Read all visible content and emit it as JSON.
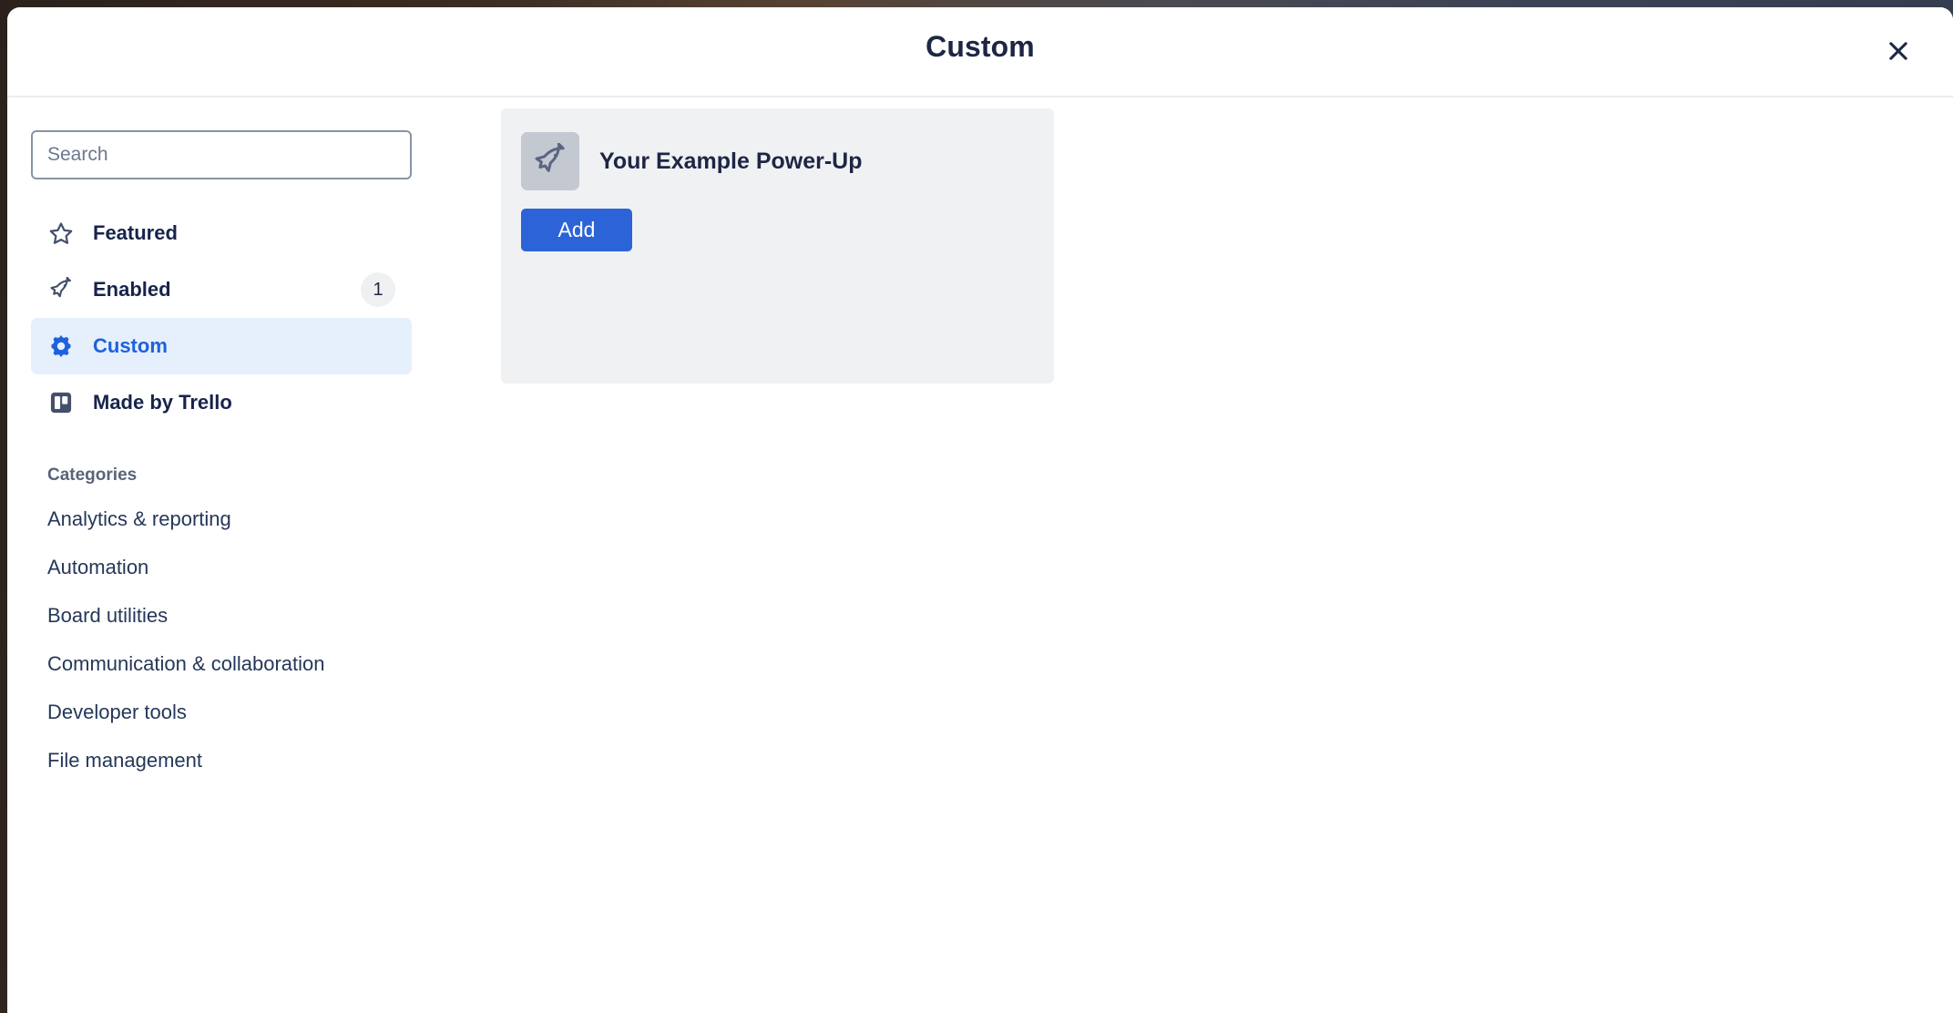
{
  "window": {
    "title": "Custom",
    "close_icon": "close-icon"
  },
  "search": {
    "placeholder": "Search",
    "value": ""
  },
  "sidebar": {
    "items": [
      {
        "label": "Featured",
        "icon": "star-icon",
        "selected": false,
        "badge": ""
      },
      {
        "label": "Enabled",
        "icon": "rocket-icon",
        "selected": false,
        "badge": "1"
      },
      {
        "label": "Custom",
        "icon": "gear-icon",
        "selected": true,
        "badge": ""
      },
      {
        "label": "Made by Trello",
        "icon": "trello-board-icon",
        "selected": false,
        "badge": ""
      }
    ],
    "categories_header": "Categories",
    "categories": [
      {
        "label": "Analytics & reporting"
      },
      {
        "label": "Automation"
      },
      {
        "label": "Board utilities"
      },
      {
        "label": "Communication & collaboration"
      },
      {
        "label": "Developer tools"
      },
      {
        "label": "File management"
      }
    ]
  },
  "main": {
    "powerups": [
      {
        "name": "Your Example Power-Up",
        "icon": "rocket-icon",
        "action_label": "Add"
      }
    ]
  },
  "colors": {
    "accent_blue": "#2c63d7",
    "selected_item_bg": "#e6effc",
    "selected_item_text": "#1e61dc",
    "card_bg": "#f0f1f3",
    "icon_tile_bg": "#c3c8d1",
    "text_primary": "#1d2644",
    "text_muted": "#5a6478"
  }
}
